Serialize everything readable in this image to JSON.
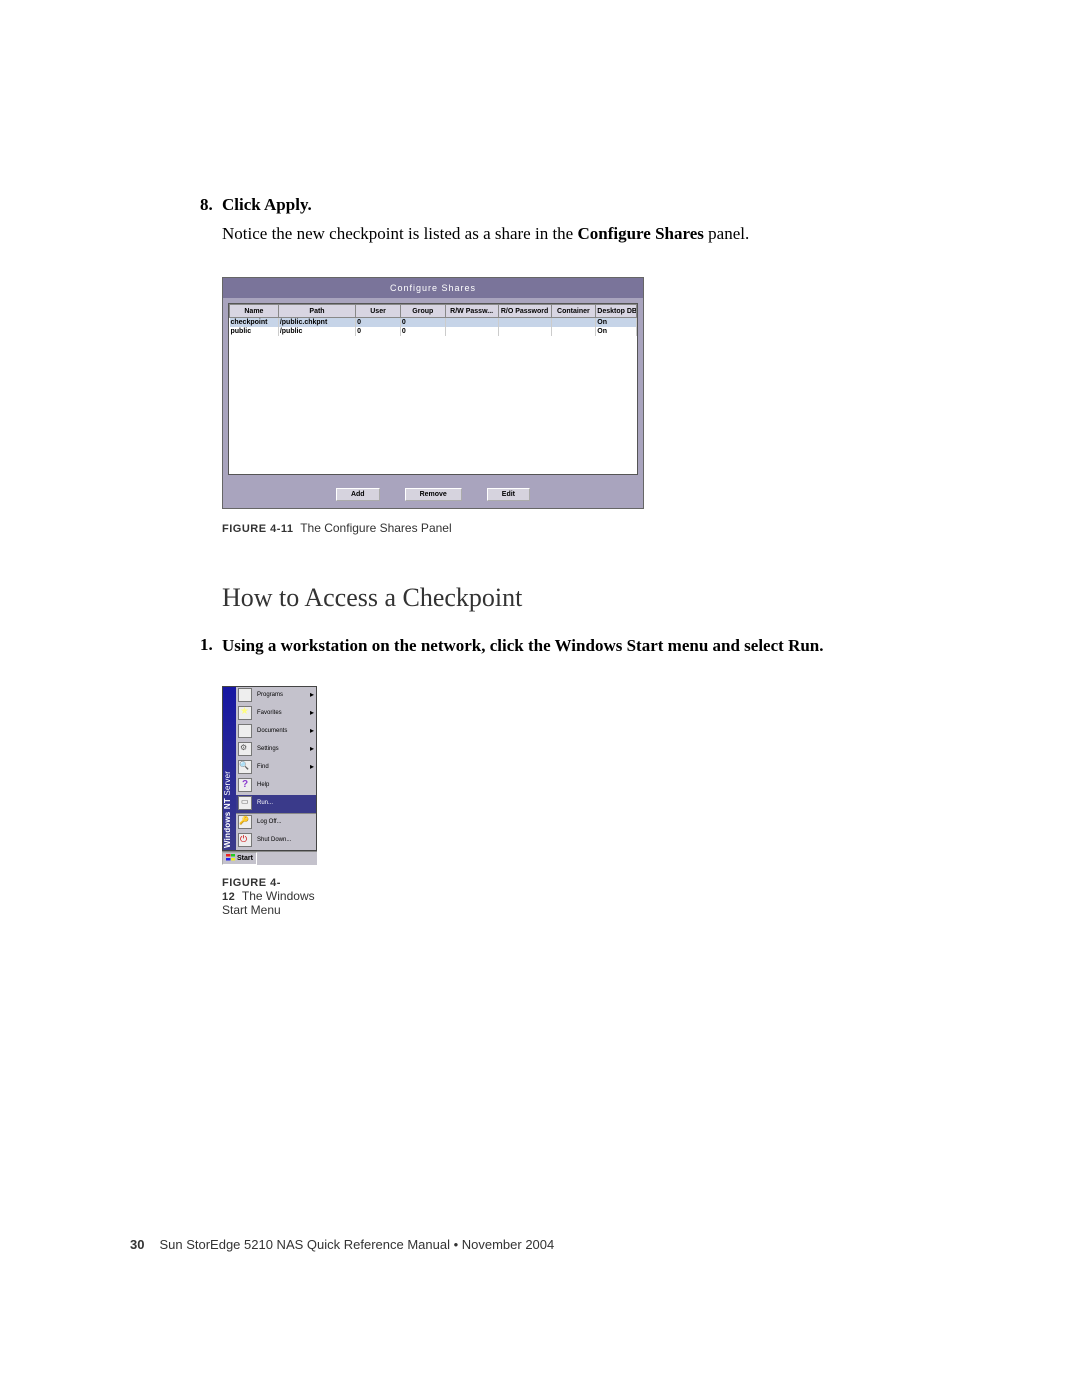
{
  "step8": {
    "num": "8.",
    "title": "Click Apply."
  },
  "notice_pre": "Notice the new checkpoint is listed as a share in the ",
  "notice_bold": "Configure Shares",
  "notice_post": " panel.",
  "panel": {
    "title": "Configure Shares",
    "headers": [
      "Name",
      "Path",
      "User",
      "Group",
      "R/W Passw...",
      "R/O Password",
      "Container",
      "Desktop DB..."
    ],
    "rows": [
      {
        "hl": true,
        "cells": [
          "checkpoint",
          "/public.chkpnt",
          "0",
          "0",
          "",
          "",
          "",
          "On"
        ]
      },
      {
        "hl": false,
        "cells": [
          "public",
          "/public",
          "0",
          "0",
          "",
          "",
          "",
          "On"
        ]
      }
    ],
    "buttons": {
      "add": "Add",
      "remove": "Remove",
      "edit": "Edit"
    }
  },
  "fig1": {
    "label": "FIGURE 4-11",
    "text": "The Configure Shares Panel"
  },
  "section_heading": "How to Access a Checkpoint",
  "step1": {
    "num": "1.",
    "title": "Using a workstation on the network, click the Windows Start menu and select Run."
  },
  "startmenu": {
    "sidebar_bold": "Windows NT",
    "sidebar_rest": " Server",
    "items": [
      {
        "label": "Programs",
        "icon": "programs-icon",
        "arrow": true
      },
      {
        "label": "Favorites",
        "icon": "favorites-icon",
        "arrow": true
      },
      {
        "label": "Documents",
        "icon": "documents-icon",
        "arrow": true
      },
      {
        "label": "Settings",
        "icon": "settings-icon",
        "arrow": true
      },
      {
        "label": "Find",
        "icon": "find-icon",
        "arrow": true
      },
      {
        "label": "Help",
        "icon": "help-icon",
        "arrow": false
      },
      {
        "label": "Run...",
        "icon": "run-icon",
        "arrow": false,
        "selected": true
      },
      {
        "label": "Log Off...",
        "icon": "logoff-icon",
        "arrow": false,
        "sep": true
      },
      {
        "label": "Shut Down...",
        "icon": "shutdown-icon",
        "arrow": false
      }
    ],
    "start_button": "Start"
  },
  "fig2": {
    "label": "FIGURE 4-12",
    "text": "The Windows Start Menu"
  },
  "footer": {
    "page": "30",
    "text": "Sun StorEdge 5210 NAS Quick Reference Manual  •  November 2004"
  }
}
